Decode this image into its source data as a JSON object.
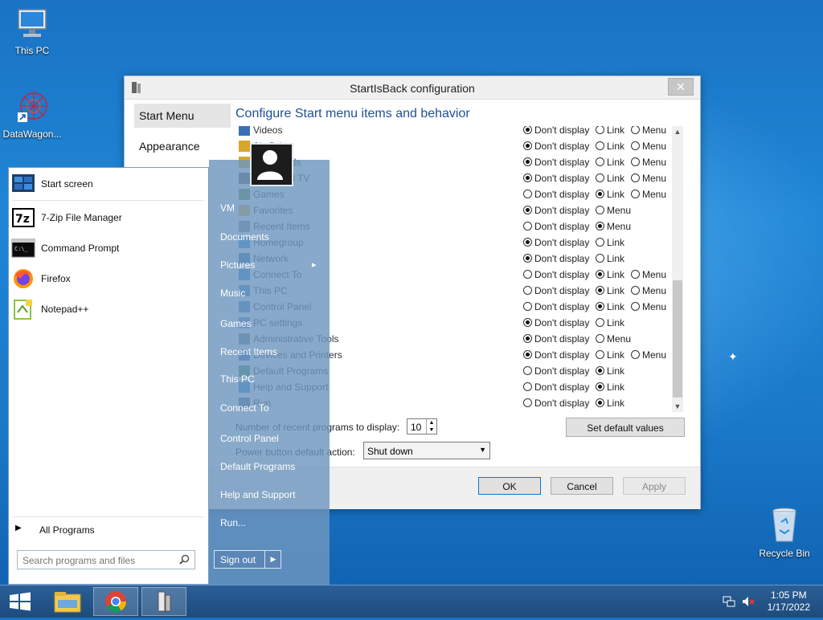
{
  "desktop": {
    "icons": [
      {
        "label": "This PC"
      },
      {
        "label": "DataWagon..."
      },
      {
        "label": "Recycle Bin"
      }
    ]
  },
  "dialog": {
    "title": "StartIsBack configuration",
    "close_glyph": "✕",
    "nav": [
      "Start Menu",
      "Appearance"
    ],
    "heading": "Configure Start menu items and behavior",
    "options": {
      "dont": "Don't display",
      "link": "Link",
      "menu": "Menu"
    },
    "items": [
      {
        "label": "Videos",
        "dont": true,
        "link": false,
        "menu": false,
        "has_menu": true
      },
      {
        "label": "SkyDrive",
        "dont": true,
        "link": false,
        "menu": false,
        "has_menu": true
      },
      {
        "label": "Downloads",
        "dont": true,
        "link": false,
        "menu": false,
        "has_menu": true
      },
      {
        "label": "Recorded TV",
        "dont": true,
        "link": false,
        "menu": false,
        "has_menu": true
      },
      {
        "label": "Games",
        "dont": false,
        "link": true,
        "menu": false,
        "has_menu": true
      },
      {
        "label": "Favorites",
        "dont": true,
        "link": null,
        "menu": false,
        "has_menu": true
      },
      {
        "label": "Recent Items",
        "dont": false,
        "link": null,
        "menu": true,
        "has_menu": true
      },
      {
        "label": "Homegroup",
        "dont": true,
        "link": false,
        "menu": null,
        "has_menu": false
      },
      {
        "label": "Network",
        "dont": true,
        "link": false,
        "menu": null,
        "has_menu": false
      },
      {
        "label": "Connect To",
        "dont": false,
        "link": true,
        "menu": false,
        "has_menu": true
      },
      {
        "label": "This PC",
        "dont": false,
        "link": true,
        "menu": false,
        "has_menu": true
      },
      {
        "label": "Control Panel",
        "dont": false,
        "link": true,
        "menu": false,
        "has_menu": true
      },
      {
        "label": "PC settings",
        "dont": true,
        "link": false,
        "menu": null,
        "has_menu": false
      },
      {
        "label": "Administrative Tools",
        "dont": true,
        "link": null,
        "menu": false,
        "has_menu": true
      },
      {
        "label": "Devices and Printers",
        "dont": true,
        "link": false,
        "menu": false,
        "has_menu": true
      },
      {
        "label": "Default Programs",
        "dont": false,
        "link": true,
        "menu": null,
        "has_menu": false
      },
      {
        "label": "Help and Support",
        "dont": false,
        "link": true,
        "menu": null,
        "has_menu": false
      },
      {
        "label": "Run",
        "dont": false,
        "link": true,
        "menu": null,
        "has_menu": false
      }
    ],
    "recent_label": "Number of recent programs to display:",
    "recent_value": "10",
    "power_label": "Power button default action:",
    "power_value": "Shut down",
    "set_default": "Set default values",
    "ok": "OK",
    "cancel": "Cancel",
    "apply": "Apply"
  },
  "start_menu": {
    "left_items": [
      "Start screen",
      "7-Zip File Manager",
      "Command Prompt",
      "Firefox",
      "Notepad++"
    ],
    "all_programs": "All Programs",
    "search_placeholder": "Search programs and files",
    "right_items": [
      "VM",
      "Documents",
      "Pictures",
      "Music",
      "Games",
      "Recent Items",
      "This PC",
      "Connect To",
      "Control Panel",
      "Default Programs",
      "Help and Support",
      "Run..."
    ],
    "sign_out": "Sign out"
  },
  "taskbar": {
    "time": "1:05 PM",
    "date": "1/17/2022"
  }
}
